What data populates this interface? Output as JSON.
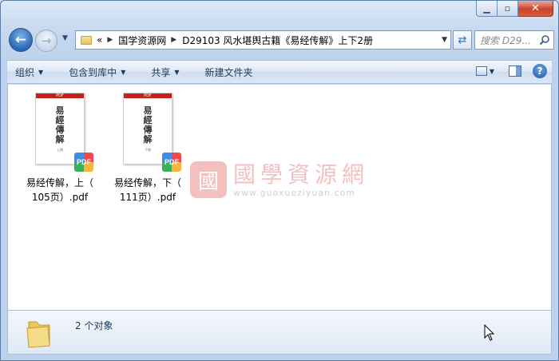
{
  "window": {
    "caption": {
      "minimize": "▁",
      "maximize": "▫",
      "close": "✕"
    }
  },
  "nav": {
    "breadcrumb_prefix": "«",
    "breadcrumb": [
      "国学资源网",
      "D29103 风水堪舆古籍《易经传解》上下2册"
    ],
    "search_placeholder": "搜索 D29..."
  },
  "toolbar": {
    "organize": "组织",
    "include_library": "包含到库中",
    "share": "共享",
    "new_folder": "新建文件夹"
  },
  "files": [
    {
      "name": "易经传解，上（105页）.pdf",
      "name_line1": "易经传解，上（",
      "name_line2": "105页）.pdf",
      "cover_title": "易經傳解",
      "cover_tag": "上冊",
      "band": "PDF",
      "badge": "PDF"
    },
    {
      "name": "易经传解，下（111页）.pdf",
      "name_line1": "易经传解，下（",
      "name_line2": "111页）.pdf",
      "cover_title": "易經傳解",
      "cover_tag": "下冊",
      "band": "PDF",
      "badge": "PDF"
    }
  ],
  "watermark": {
    "seal": "國",
    "cn": "國學資源網",
    "url": "www.guoxueziyuan.com"
  },
  "status": {
    "count_text": "2 个对象"
  },
  "colors": {
    "accent": "#2867b3",
    "pdf_red": "#c2211c",
    "window_bg": "#c6d8ef"
  }
}
